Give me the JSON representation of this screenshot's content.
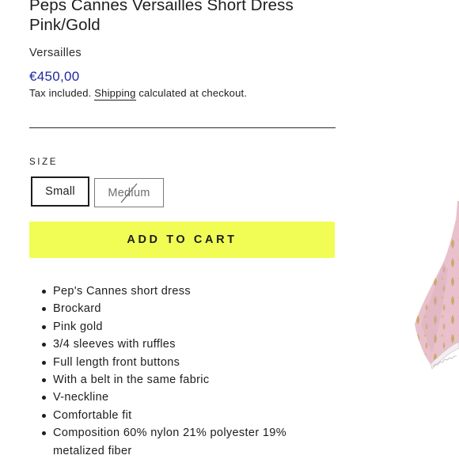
{
  "product": {
    "title": "Peps Cannes Versailles Short Dress Pink/Gold",
    "vendor": "Versailles",
    "price": "€450,00",
    "tax_note_prefix": "Tax included.",
    "shipping_link": "Shipping",
    "tax_note_suffix": "calculated at checkout."
  },
  "size_selector": {
    "label": "SIZE",
    "options": [
      {
        "label": "Small",
        "selected": true,
        "available": true
      },
      {
        "label": "Medium",
        "selected": false,
        "available": false
      }
    ]
  },
  "cart": {
    "add_to_cart_label": "ADD TO CART",
    "button_color": "#f1fd55"
  },
  "features": [
    "Pep's Cannes short dress",
    "Brockard",
    "Pink gold",
    "3/4 sleeves with ruffles",
    "Full length front buttons",
    "With a belt in the same fabric",
    "V-neckline",
    "Comfortable fit",
    "Composition 60% nylon 21% polyester 19% metalized fiber"
  ],
  "colors": {
    "price": "#1f2a9e",
    "text": "#1c1d1d",
    "dress_pink": "#e9c3cf",
    "dress_gold": "#c6a25a"
  }
}
